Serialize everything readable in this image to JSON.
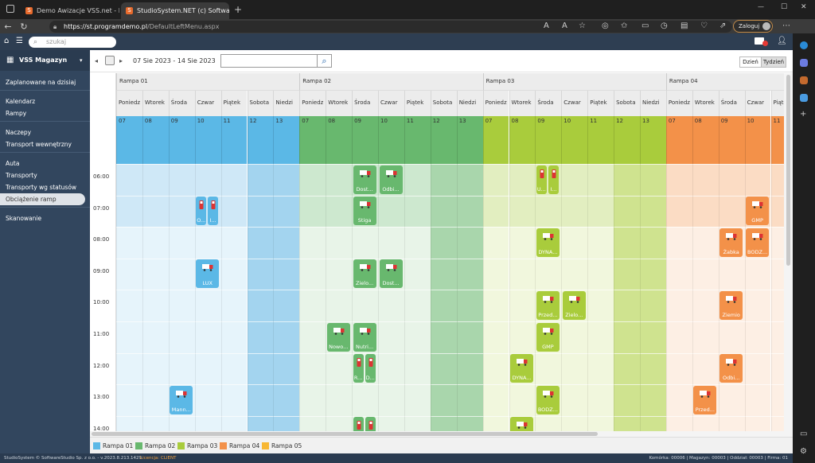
{
  "browser": {
    "tabs": [
      {
        "title": "Demo Awizacje VSS.net - Demo",
        "active": false
      },
      {
        "title": "StudioSystem.NET (c) SoftwareSt",
        "active": true
      }
    ],
    "url_host": "https://st.programdemo.pl",
    "url_path": "/DefaultLeftMenu.aspx",
    "login_label": "Zaloguj"
  },
  "app": {
    "search_placeholder": "szukaj",
    "sidebar_title": "VSS Magazyn",
    "menu": [
      {
        "label": "Zaplanowane na dzisiaj",
        "group": 0
      },
      {
        "label": "Kalendarz",
        "group": 1
      },
      {
        "label": "Rampy",
        "group": 1
      },
      {
        "label": "Naczepy",
        "group": 2
      },
      {
        "label": "Transport wewnętrzny",
        "group": 2
      },
      {
        "label": "Auta",
        "group": 3
      },
      {
        "label": "Transporty",
        "group": 3
      },
      {
        "label": "Transporty wg statusów",
        "group": 3
      },
      {
        "label": "Obciążenie ramp",
        "group": 3,
        "selected": true
      },
      {
        "label": "Skanowanie",
        "group": 4
      }
    ]
  },
  "toolbar": {
    "date_range": "07 Sie 2023 - 14 Sie 2023",
    "search_value": "",
    "view_day": "Dzień",
    "view_week": "Tydzień"
  },
  "calendar": {
    "ramps": [
      {
        "name": "Rampa 01",
        "color": "#5bb8e6",
        "light": "#cfe8f7",
        "lighter": "#e6f4fb",
        "dark": "#a3d4ef"
      },
      {
        "name": "Rampa 02",
        "color": "#68b86e",
        "light": "#cde8cf",
        "lighter": "#e8f4e8",
        "dark": "#a9d6ac"
      },
      {
        "name": "Rampa 03",
        "color": "#a9cc3c",
        "light": "#e2eec0",
        "lighter": "#f1f7dd",
        "dark": "#cfe38f"
      },
      {
        "name": "Rampa 04",
        "color": "#f39149",
        "light": "#fbdcc4",
        "lighter": "#fdefe4",
        "dark": "#f8be94"
      }
    ],
    "days": [
      "Poniedz",
      "Wtorek",
      "Środa",
      "Czwar",
      "Piątek",
      "Sobota",
      "Niedzi"
    ],
    "dates": [
      "07",
      "08",
      "09",
      "10",
      "11",
      "12",
      "13"
    ],
    "hours": [
      "06:00",
      "07:00",
      "08:00",
      "09:00",
      "10:00",
      "11:00",
      "12:00",
      "13:00",
      "14:00"
    ],
    "bookings": [
      {
        "ramp": 1,
        "day": 2,
        "hour": 0,
        "label": "Dost..."
      },
      {
        "ramp": 1,
        "day": 3,
        "hour": 0,
        "label": "Odbi..."
      },
      {
        "ramp": 2,
        "day": 2,
        "hour": 0,
        "label": "U...",
        "narrow": 1
      },
      {
        "ramp": 2,
        "day": 2,
        "hour": 0,
        "label": "I...",
        "narrow": 2
      },
      {
        "ramp": 0,
        "day": 3,
        "hour": 1,
        "label": "O...",
        "narrow": 1
      },
      {
        "ramp": 0,
        "day": 3,
        "hour": 1,
        "label": "I...",
        "narrow": 2
      },
      {
        "ramp": 1,
        "day": 2,
        "hour": 1,
        "label": "Stiga"
      },
      {
        "ramp": 3,
        "day": 3,
        "hour": 1,
        "label": "GMP"
      },
      {
        "ramp": 2,
        "day": 2,
        "hour": 2,
        "label": "DYNA..."
      },
      {
        "ramp": 3,
        "day": 2,
        "hour": 2,
        "label": "Żabka"
      },
      {
        "ramp": 3,
        "day": 3,
        "hour": 2,
        "label": "BODZ..."
      },
      {
        "ramp": 0,
        "day": 3,
        "hour": 3,
        "label": "LUX"
      },
      {
        "ramp": 1,
        "day": 2,
        "hour": 3,
        "label": "Zielo..."
      },
      {
        "ramp": 1,
        "day": 3,
        "hour": 3,
        "label": "Dost..."
      },
      {
        "ramp": 2,
        "day": 2,
        "hour": 4,
        "label": "Przed..."
      },
      {
        "ramp": 2,
        "day": 3,
        "hour": 4,
        "label": "Zielo..."
      },
      {
        "ramp": 3,
        "day": 2,
        "hour": 4,
        "label": "Ziemio"
      },
      {
        "ramp": 1,
        "day": 1,
        "hour": 5,
        "label": "Nowo..."
      },
      {
        "ramp": 1,
        "day": 2,
        "hour": 5,
        "label": "Nutri..."
      },
      {
        "ramp": 2,
        "day": 2,
        "hour": 5,
        "label": "GMP"
      },
      {
        "ramp": 1,
        "day": 2,
        "hour": 6,
        "label": "R...",
        "narrow": 1
      },
      {
        "ramp": 1,
        "day": 2,
        "hour": 6,
        "label": "D...",
        "narrow": 2
      },
      {
        "ramp": 2,
        "day": 1,
        "hour": 6,
        "label": "DYNA..."
      },
      {
        "ramp": 3,
        "day": 2,
        "hour": 6,
        "label": "Odbi..."
      },
      {
        "ramp": 0,
        "day": 2,
        "hour": 7,
        "label": "Mann..."
      },
      {
        "ramp": 2,
        "day": 2,
        "hour": 7,
        "label": "BODZ..."
      },
      {
        "ramp": 3,
        "day": 1,
        "hour": 7,
        "label": "Przed..."
      },
      {
        "ramp": 1,
        "day": 2,
        "hour": 8,
        "label": "",
        "narrow": 1
      },
      {
        "ramp": 1,
        "day": 2,
        "hour": 8,
        "label": "",
        "narrow": 2
      },
      {
        "ramp": 2,
        "day": 1,
        "hour": 8,
        "label": ""
      }
    ]
  },
  "legend": [
    {
      "label": "Rampa 01",
      "color": "#5bb8e6"
    },
    {
      "label": "Rampa 02",
      "color": "#68b86e"
    },
    {
      "label": "Rampa 03",
      "color": "#a9cc3c"
    },
    {
      "label": "Rampa 04",
      "color": "#f39149"
    },
    {
      "label": "Rampa 05",
      "color": "#f7b733"
    }
  ],
  "status": {
    "left": "StudioSystem © SoftwareStudio Sp. z o.o. - v.2023.8.213.1429",
    "license": "Licencja: CLIENT",
    "right": "Komórka: 00006 | Magazyn: 00003 | Oddział: 00003 | Firma: 01"
  }
}
